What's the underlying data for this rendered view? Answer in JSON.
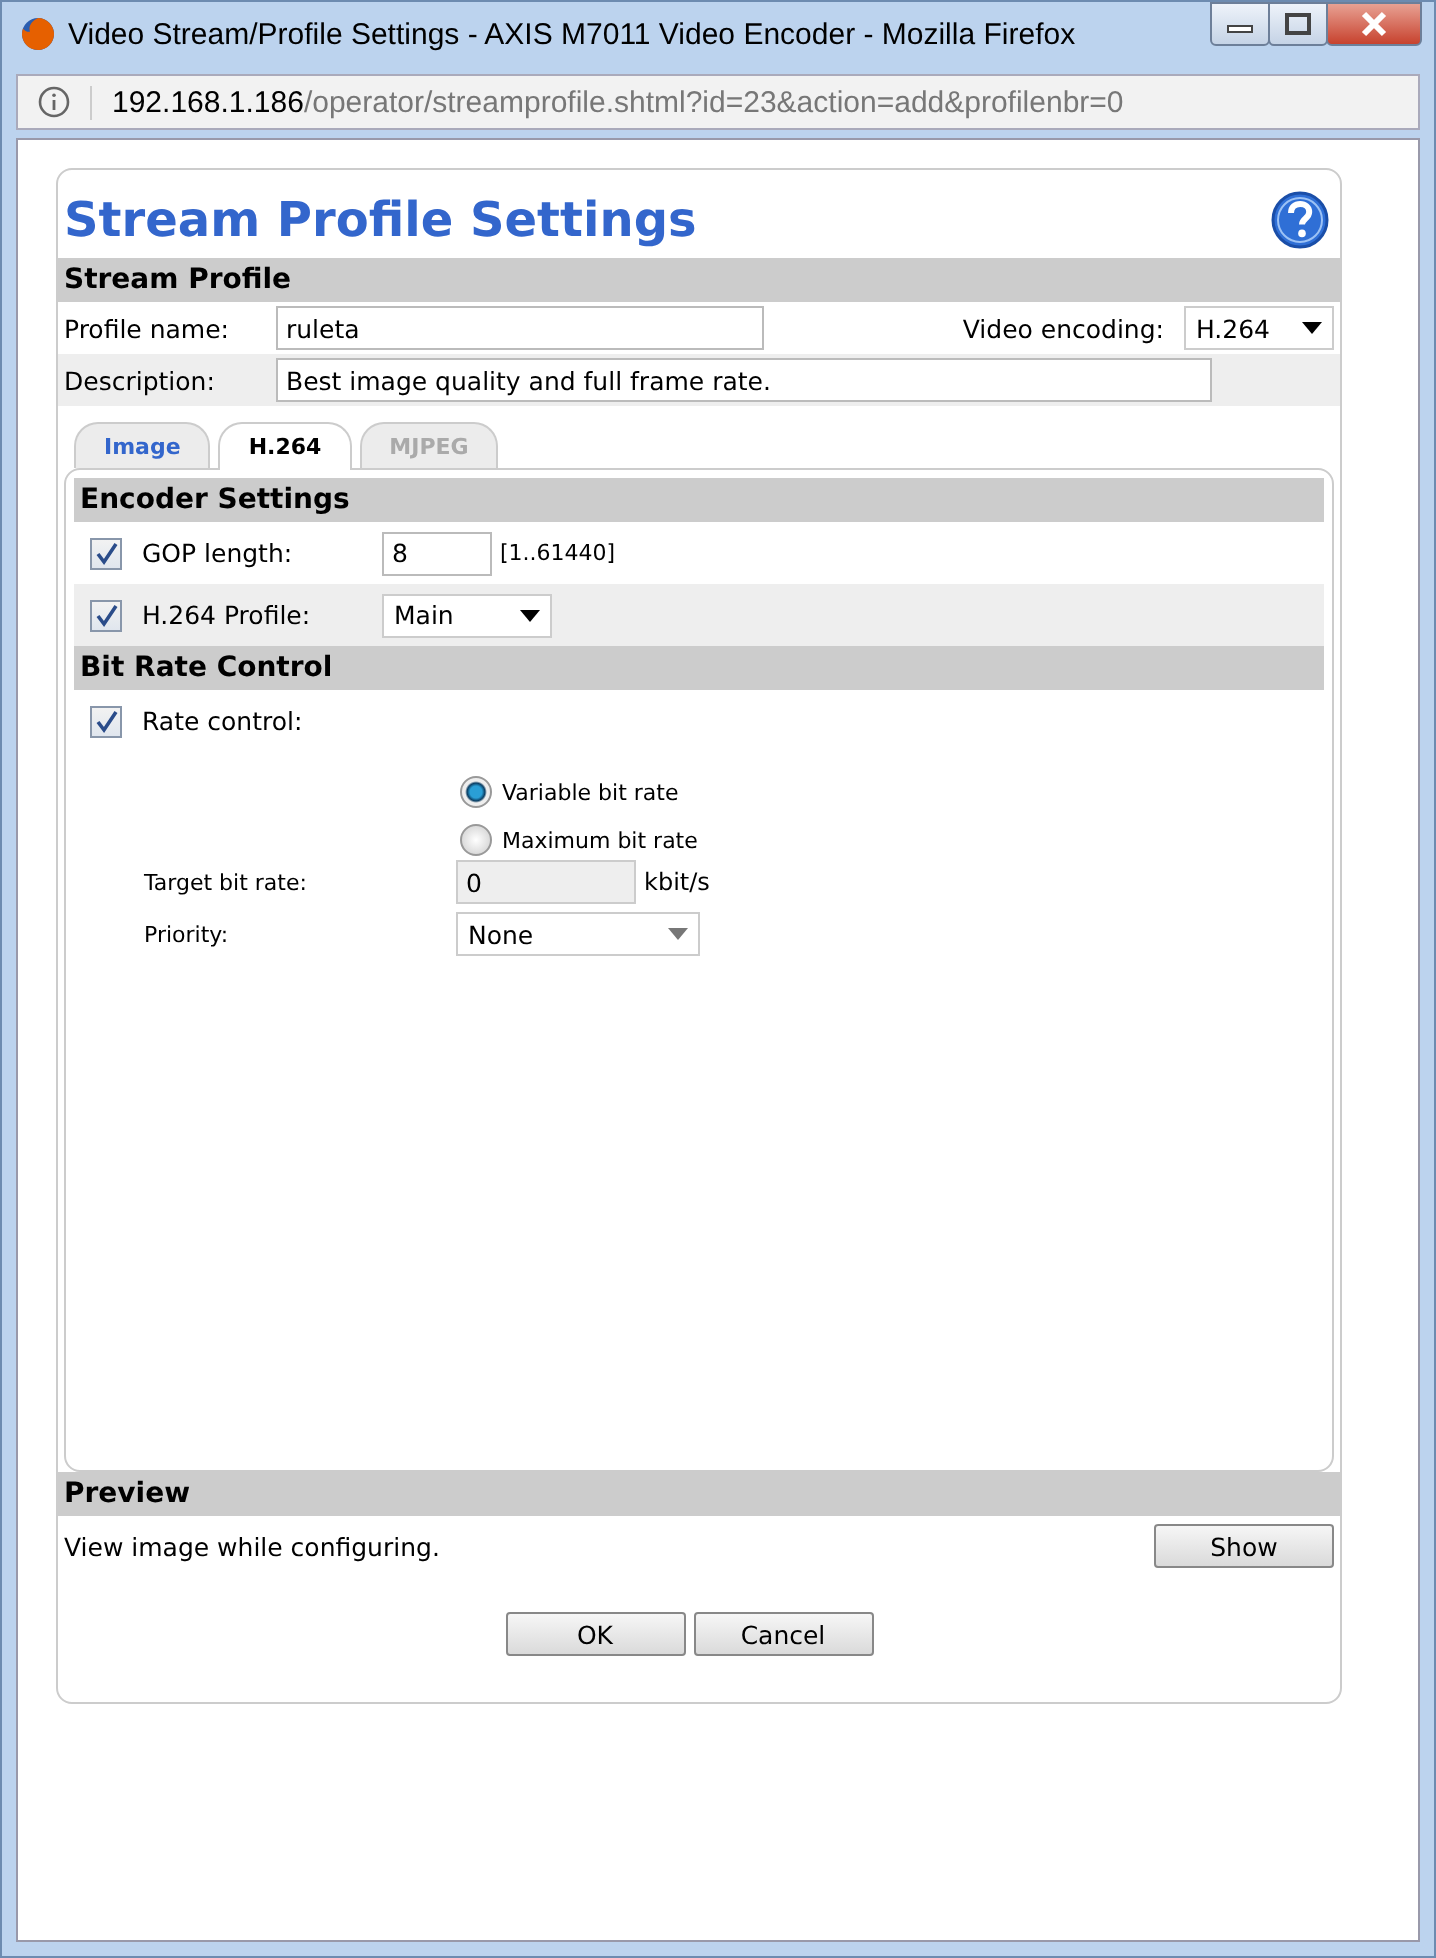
{
  "window": {
    "title": "Video Stream/Profile Settings - AXIS M7011 Video Encoder - Mozilla Firefox"
  },
  "address_bar": {
    "host": "192.168.1.186",
    "path": "/operator/streamprofile.shtml?id=23&action=add&profilenbr=0"
  },
  "page_title": "Stream Profile Settings",
  "stream_profile": {
    "heading": "Stream Profile",
    "profile_name_label": "Profile name:",
    "profile_name": "ruleta",
    "video_encoding_label": "Video encoding:",
    "video_encoding": "H.264",
    "description_label": "Description:",
    "description": "Best image quality and full frame rate."
  },
  "tabs": [
    {
      "label": "Image",
      "selected": false,
      "disabled": false
    },
    {
      "label": "H.264",
      "selected": true,
      "disabled": false
    },
    {
      "label": "MJPEG",
      "selected": false,
      "disabled": true
    }
  ],
  "encoder_settings": {
    "heading": "Encoder Settings",
    "gop_label": "GOP length:",
    "gop_checked": true,
    "gop_value": "8",
    "gop_range": "[1..61440]",
    "profile_label": "H.264 Profile:",
    "profile_checked": true,
    "profile_value": "Main"
  },
  "bit_rate_control": {
    "heading": "Bit Rate Control",
    "rate_control_label": "Rate control:",
    "rate_control_checked": true,
    "modes": [
      {
        "label": "Variable bit rate",
        "selected": true
      },
      {
        "label": "Maximum bit rate",
        "selected": false
      }
    ],
    "target_label": "Target bit rate:",
    "target_value": "0",
    "target_disabled": true,
    "target_unit": "kbit/s",
    "priority_label": "Priority:",
    "priority_value": "None"
  },
  "preview": {
    "heading": "Preview",
    "text": "View image while configuring.",
    "button": "Show"
  },
  "buttons": [
    "OK",
    "Cancel"
  ]
}
